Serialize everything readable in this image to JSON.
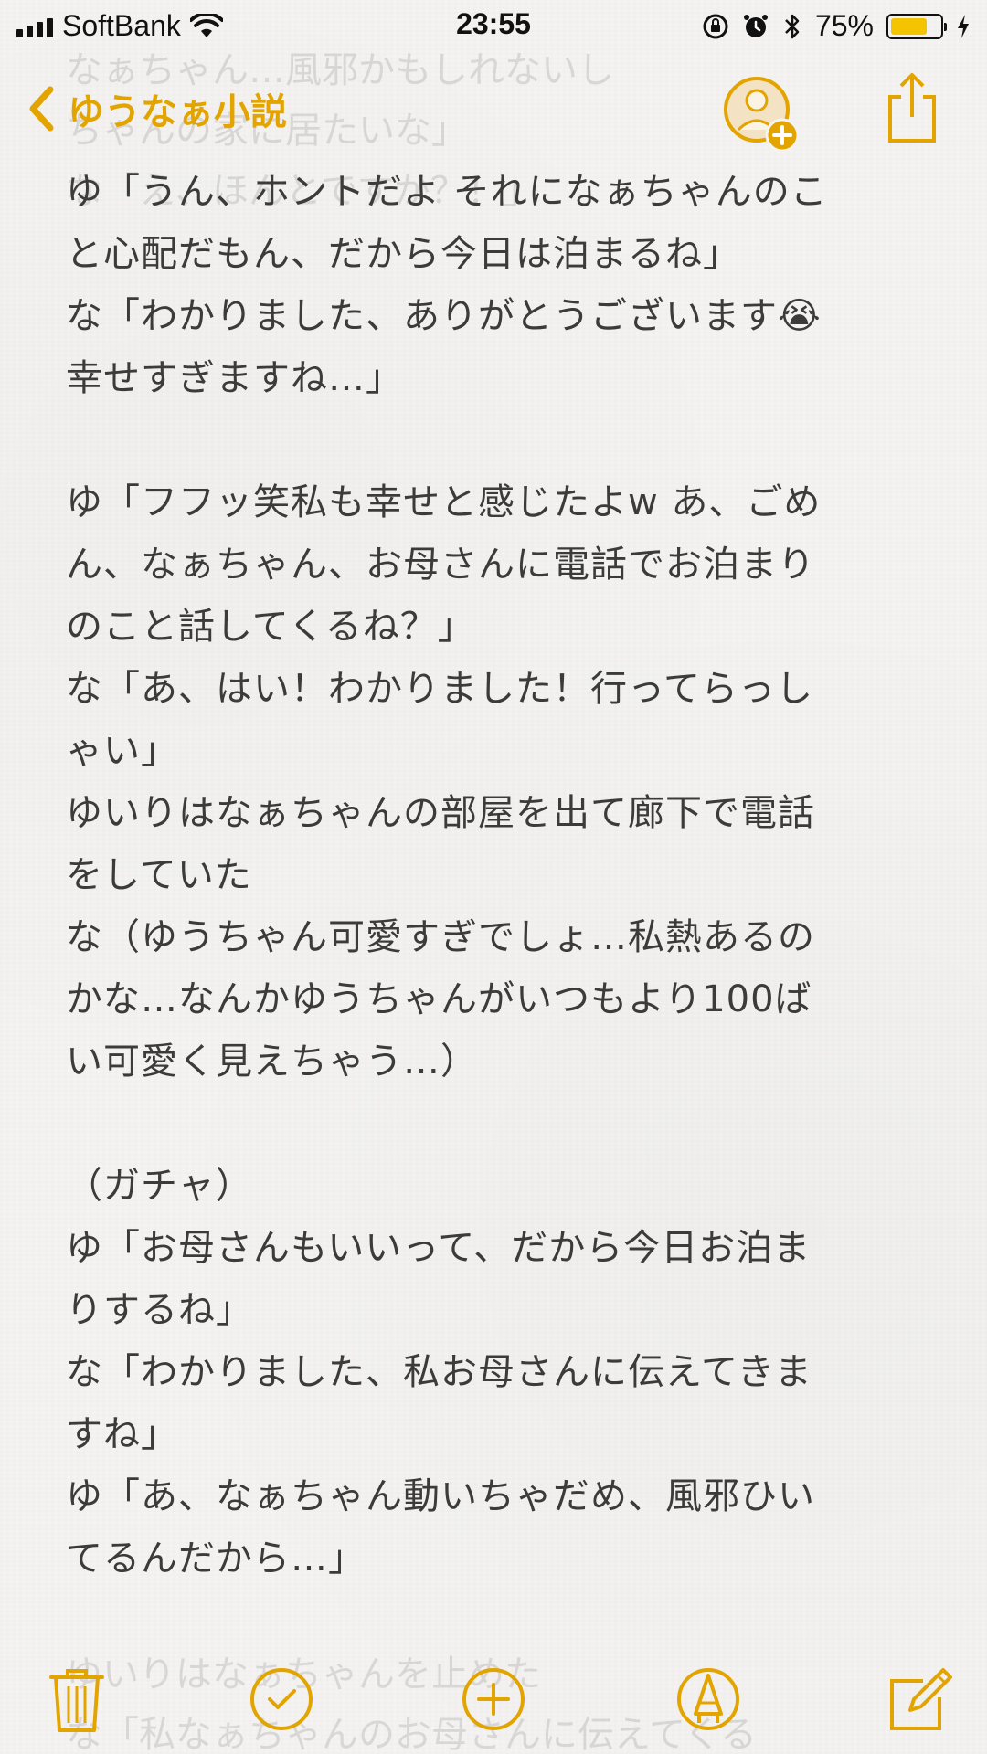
{
  "status_bar": {
    "carrier": "SoftBank",
    "time": "23:55",
    "battery_percent_text": "75%",
    "battery_level": 0.75
  },
  "nav": {
    "back_label": "ゆうなぁ小説"
  },
  "note": {
    "faded_top_lines": [
      "なぁちゃん…風邪かもしれないし",
      "ちゃんの家に居たいな」",
      "な「え、ほんとですか？！」"
    ],
    "lines": [
      "ゆ「うん、ホントだよ それになぁちゃんのこ",
      "と心配だもん、だから今日は泊まるね」",
      "な「わかりました、ありがとうございます😭",
      "幸せすぎますね…」",
      "",
      "ゆ「フフッ笑私も幸せと感じたよw あ、ごめ",
      "ん、なぁちゃん、お母さんに電話でお泊まり",
      "のこと話してくるね？」",
      "な「あ、はい！わかりました！行ってらっし",
      "ゃい」",
      "ゆいりはなぁちゃんの部屋を出て廊下で電話",
      "をしていた",
      "な（ゆうちゃん可愛すぎでしょ…私熱あるの",
      "かな…なんかゆうちゃんがいつもより100ば",
      "い可愛く見えちゃう…）",
      "",
      "（ガチャ）",
      "ゆ「お母さんもいいって、だから今日お泊ま",
      "りするね」",
      "な「わかりました、私お母さんに伝えてきま",
      "すね」",
      "ゆ「あ、なぁちゃん動いちゃだめ、風邪ひい",
      "てるんだから…」"
    ],
    "faded_bottom_lines": [
      "ゆいりはなぁちゃんを止めた",
      "な「私なぁちゃんのお母さんに伝えてくる"
    ]
  },
  "icons": {
    "back": "chevron-left-icon",
    "add_person": "add-person-icon",
    "share": "share-icon",
    "trash": "trash-icon",
    "checklist": "checkmark-circle-icon",
    "add": "plus-circle-icon",
    "markup": "pen-tip-circle-icon",
    "compose": "compose-icon"
  },
  "colors": {
    "accent": "#e3a400",
    "text": "#3b3b3b",
    "paper": "#f4f3f1",
    "battery": "#f5c400"
  }
}
